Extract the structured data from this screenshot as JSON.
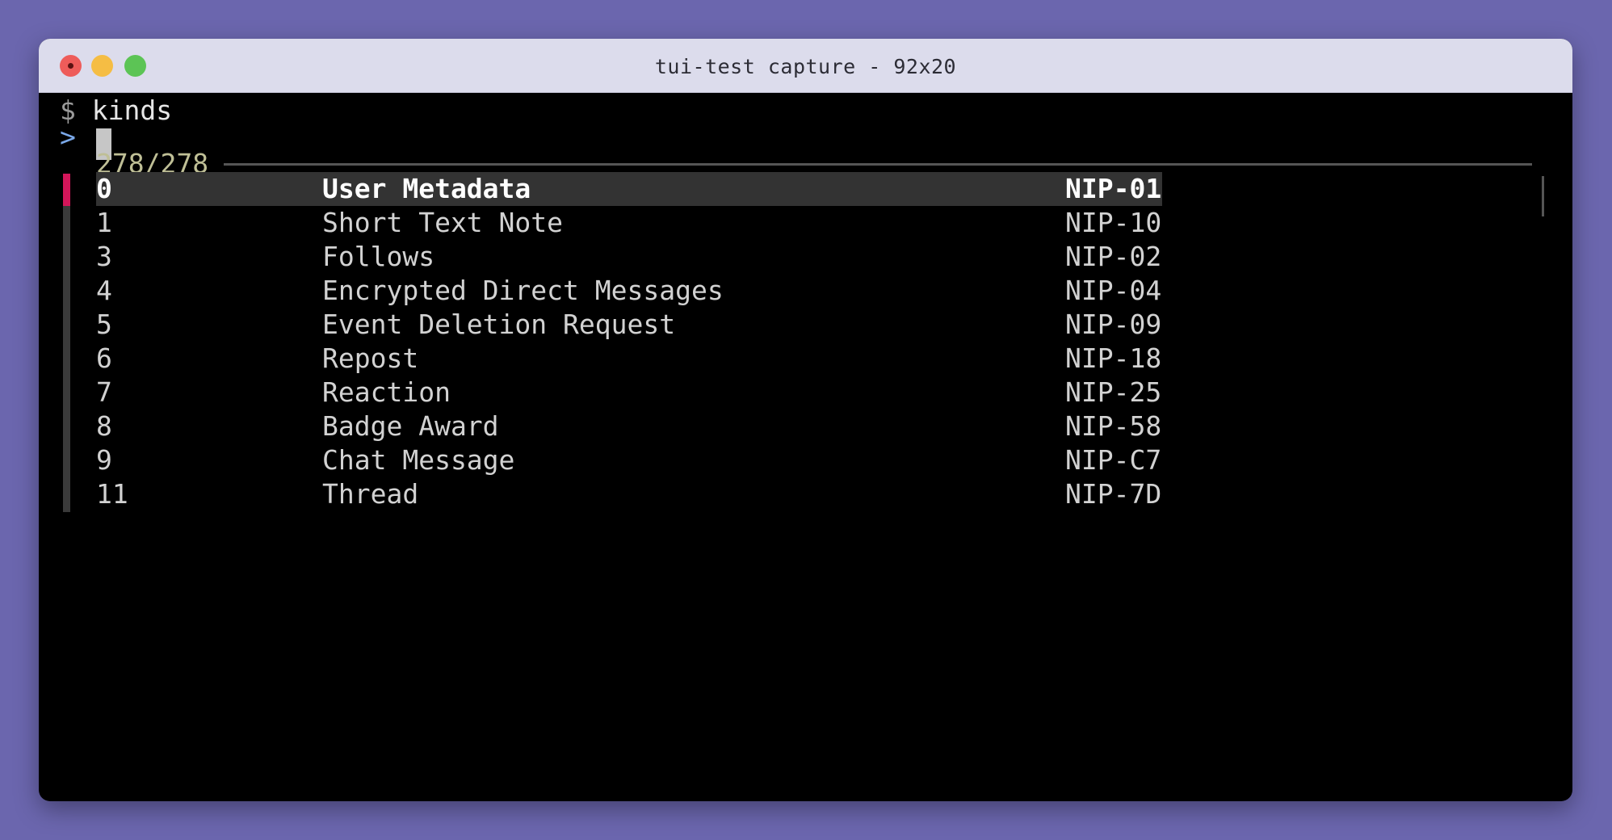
{
  "window": {
    "title": "tui-test capture - 92x20"
  },
  "terminal": {
    "prompt_symbol": "$",
    "command": "kinds",
    "input_symbol": ">",
    "input_value": "",
    "counter": "278/278"
  },
  "rows": [
    {
      "kind": "0",
      "name": "User Metadata",
      "nip": "NIP-01",
      "selected": true
    },
    {
      "kind": "1",
      "name": "Short Text Note",
      "nip": "NIP-10"
    },
    {
      "kind": "3",
      "name": "Follows",
      "nip": "NIP-02"
    },
    {
      "kind": "4",
      "name": "Encrypted Direct Messages",
      "nip": "NIP-04"
    },
    {
      "kind": "5",
      "name": "Event Deletion Request",
      "nip": "NIP-09"
    },
    {
      "kind": "6",
      "name": "Repost",
      "nip": "NIP-18"
    },
    {
      "kind": "7",
      "name": "Reaction",
      "nip": "NIP-25"
    },
    {
      "kind": "8",
      "name": "Badge Award",
      "nip": "NIP-58"
    },
    {
      "kind": "9",
      "name": "Chat Message",
      "nip": "NIP-C7"
    },
    {
      "kind": "11",
      "name": "Thread",
      "nip": "NIP-7D"
    }
  ],
  "colors": {
    "background": "#6b66ae",
    "titlebar": "#dcdcec",
    "terminal_bg": "#000000",
    "selection_accent": "#d4165a",
    "selection_bg": "#333333",
    "counter_text": "#bfbf96",
    "input_symbol": "#7aa8e8"
  }
}
